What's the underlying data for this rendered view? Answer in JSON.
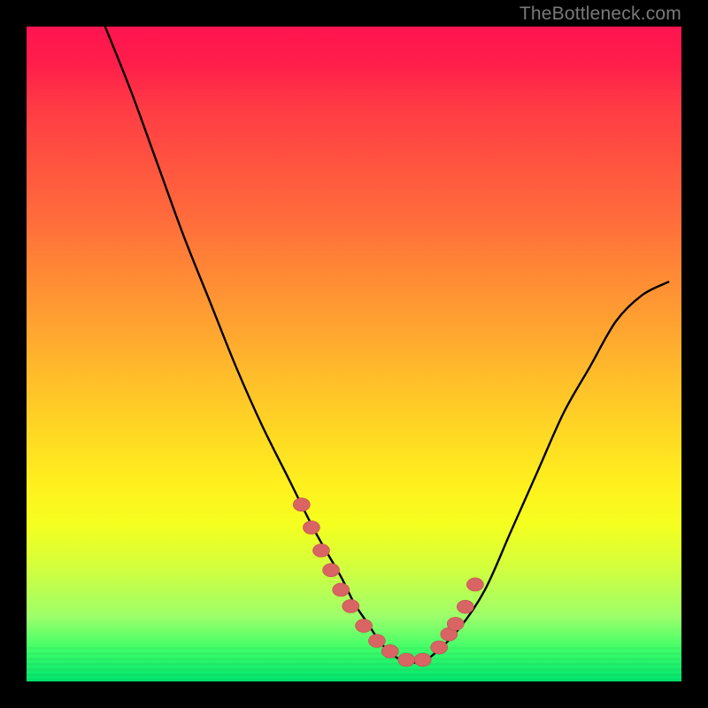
{
  "watermark": "TheBottleneck.com",
  "colors": {
    "background": "#000000",
    "curve_stroke": "#000000",
    "marker_fill": "#d86464",
    "marker_stroke": "#c24f4f"
  },
  "chart_data": {
    "type": "line",
    "title": "",
    "xlabel": "",
    "ylabel": "",
    "xlim": [
      0,
      100
    ],
    "ylim": [
      0,
      100
    ],
    "grid": false,
    "legend": false,
    "series": [
      {
        "name": "curve",
        "x": [
          12,
          16,
          20,
          24,
          28,
          32,
          36,
          40,
          44,
          48,
          50,
          52,
          54,
          56,
          58,
          60,
          62,
          66,
          70,
          74,
          78,
          82,
          86,
          90,
          94,
          98
        ],
        "values": [
          100,
          90,
          79,
          68,
          58,
          48,
          39,
          31,
          23,
          16,
          12,
          9,
          6,
          4,
          3,
          3,
          4,
          8,
          14,
          23,
          32,
          41,
          48,
          55,
          59,
          61
        ]
      }
    ],
    "markers": {
      "name": "highlight-points",
      "x": [
        42,
        43.5,
        45,
        46.5,
        48,
        49.5,
        51.5,
        53.5,
        55.5,
        58,
        60.5,
        63,
        64.5,
        65.5,
        67,
        68.5
      ],
      "values": [
        27,
        23.5,
        20,
        17,
        14,
        11.5,
        8.5,
        6.2,
        4.6,
        3.3,
        3.3,
        5.2,
        7.2,
        8.8,
        11.4,
        14.8
      ]
    }
  }
}
